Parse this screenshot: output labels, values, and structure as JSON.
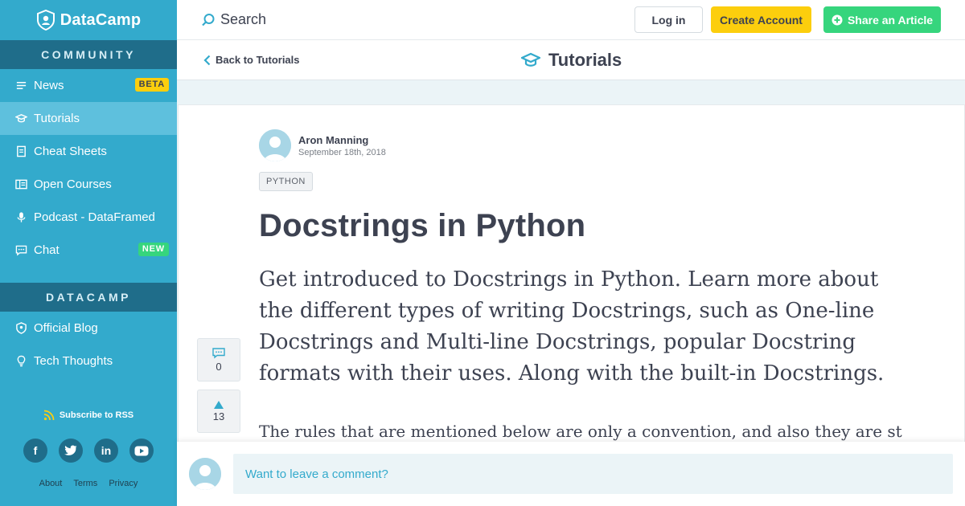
{
  "brand": {
    "name": "DataCamp"
  },
  "sidebar": {
    "community_heading": "COMMUNITY",
    "community_items": [
      {
        "label": "News",
        "icon": "lines-icon",
        "badge": "BETA"
      },
      {
        "label": "Tutorials",
        "icon": "graduation-cap-icon",
        "active": true
      },
      {
        "label": "Cheat Sheets",
        "icon": "document-icon"
      },
      {
        "label": "Open Courses",
        "icon": "book-icon"
      },
      {
        "label": "Podcast - DataFramed",
        "icon": "microphone-icon"
      },
      {
        "label": "Chat",
        "icon": "chat-icon",
        "badge": "NEW"
      }
    ],
    "datacamp_heading": "DATACAMP",
    "datacamp_items": [
      {
        "label": "Official Blog",
        "icon": "shield-icon"
      },
      {
        "label": "Tech Thoughts",
        "icon": "lightbulb-icon"
      }
    ],
    "rss_label": "Subscribe to RSS",
    "socials": [
      "f",
      "t",
      "in",
      "yt"
    ],
    "footer_links": [
      "About",
      "Terms",
      "Privacy"
    ]
  },
  "topbar": {
    "search_label": "Search",
    "login_label": "Log in",
    "create_label": "Create Account",
    "share_label": "Share an Article"
  },
  "subbar": {
    "back_label": "Back to Tutorials",
    "section_title": "Tutorials"
  },
  "article": {
    "author": "Aron Manning",
    "date": "September 18th, 2018",
    "tag": "PYTHON",
    "title": "Docstrings in Python",
    "lead": "Get introduced to Docstrings in Python. Learn more about the different types of writing Docstrings, such as One-line Docstrings and Multi-line Docstrings, popular Docstring formats with their uses. Along with the built-in Docstrings.",
    "body_start": "The rules that are mentioned below are only a convention, and also they are strictly",
    "comments_count": "0",
    "upvotes_count": "13"
  },
  "comment": {
    "placeholder": "Want to leave a comment?"
  },
  "colors": {
    "sidebar": "#33aacc",
    "section_head": "#1f6d8a",
    "accent_yellow": "#fcce0d",
    "accent_green": "#36d57d"
  }
}
